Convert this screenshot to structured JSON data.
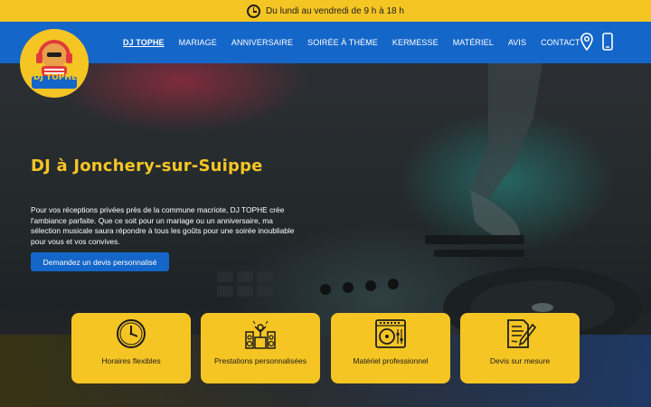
{
  "topbar": {
    "hours": "Du lundi au vendredi de 9 h à 18 h"
  },
  "logo": {
    "text": "DJ TOPHE"
  },
  "nav": {
    "items": [
      {
        "label": "DJ TOPHE",
        "active": true
      },
      {
        "label": "MARIAGE"
      },
      {
        "label": "ANNIVERSAIRE"
      },
      {
        "label": "SOIRÉE À THÈME"
      },
      {
        "label": "KERMESSE"
      },
      {
        "label": "MATÉRIEL"
      },
      {
        "label": "AVIS"
      },
      {
        "label": "CONTACT"
      }
    ],
    "icons": [
      "location-pin-icon",
      "phone-icon"
    ]
  },
  "hero": {
    "title": "DJ à Jonchery-sur-Suippe",
    "text": "Pour vos réceptions privées près de la commune macriote, DJ TOPHE crée l'ambiance parfaite. Que ce soit pour un mariage ou un anniversaire, ma sélection musicale saura répondre à tous les goûts pour une soirée inoubliable pour vous et vos convives.",
    "cta": "Demandez un devis personnalisé"
  },
  "features": [
    {
      "label": "Horaires flexibles",
      "icon": "clock-icon"
    },
    {
      "label": "Prestations personnalisées",
      "icon": "dj-speakers-icon"
    },
    {
      "label": "Matériel professionnel",
      "icon": "turntable-icon"
    },
    {
      "label": "Devis sur mesure",
      "icon": "document-pen-icon"
    }
  ],
  "colors": {
    "yellow": "#f5c524",
    "blue": "#1566c9",
    "dark": "#1d1d1d"
  }
}
